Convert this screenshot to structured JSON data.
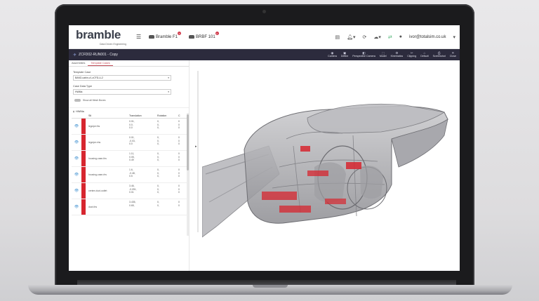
{
  "app": {
    "logo": "bramble",
    "logo_tagline": "Data Driven Engineering",
    "tabs": [
      {
        "label": "Bramble F1"
      },
      {
        "label": "BRBF 101"
      }
    ],
    "user_email": "ivor@totalsim.co.uk"
  },
  "toolbar": {
    "project_title": "ZCFD02-RUN001 - Copy",
    "buttons": [
      {
        "label": "Camera",
        "icon": "camera-icon"
      },
      {
        "label": "Define",
        "icon": "define-icon"
      },
      {
        "label": "Perspective Camera",
        "icon": "perspective-camera-icon"
      },
      {
        "label": "Model",
        "icon": "model-icon"
      },
      {
        "label": "Kinematics",
        "icon": "kinematics-icon"
      },
      {
        "label": "Clipping",
        "icon": "clipping-icon"
      },
      {
        "label": "Default",
        "icon": "default-icon"
      },
      {
        "label": "Screenshot",
        "icon": "screenshot-icon"
      },
      {
        "label": "Close",
        "icon": "close-icon"
      }
    ]
  },
  "panel": {
    "tabs": [
      {
        "label": "Assemblies"
      },
      {
        "label": "Template Cases"
      }
    ],
    "template_case_label": "Template Case",
    "template_case_value": "BAND-cabin-v1-zCFD-LL2",
    "case_data_type_label": "Case Data Type",
    "case_data_type_value": "HWMa",
    "toggle_label": "Show all Mesh Boxes",
    "section_title": "HWMa",
    "table": {
      "headers": [
        "Stl",
        "Translation",
        "Rotation",
        "C"
      ],
      "rows": [
        {
          "stl": "legclpe.ths",
          "translation": [
            "0.01,",
            "0.0,",
            "0.0"
          ],
          "rotation": [
            "0,",
            "0,",
            "0,"
          ],
          "extra": [
            "0",
            "0",
            "0"
          ]
        },
        {
          "stl": "legclpe.nhs",
          "translation": [
            "0.01,",
            "-0.03,",
            "0.0"
          ],
          "rotation": [
            "0,",
            "0,",
            "0,"
          ],
          "extra": [
            "0",
            "0",
            "0"
          ]
        },
        {
          "stl": "housing-case-ths",
          "translation": [
            "1.11,",
            "0.05,",
            "0.49"
          ],
          "rotation": [
            "0,",
            "0,",
            "0,"
          ],
          "extra": [
            "0",
            "0",
            "0"
          ]
        },
        {
          "stl": "housing-case-rhs",
          "translation": [
            "1.6,",
            "-0.48,",
            "0.5"
          ],
          "rotation": [
            "0,",
            "0,",
            "0,"
          ],
          "extra": [
            "0",
            "0",
            "0"
          ]
        },
        {
          "stl": "centre-duct-outlet",
          "translation": [
            "3.46,",
            "-0.091,",
            "0.01"
          ],
          "rotation": [
            "0,",
            "0,",
            "0,"
          ],
          "extra": [
            "0",
            "0",
            "0"
          ]
        },
        {
          "stl": "duct-ths",
          "translation": [
            "3.435,",
            "0.65,",
            ""
          ],
          "rotation": [
            "0,",
            "0,",
            ""
          ],
          "extra": [
            "0",
            "0",
            ""
          ]
        }
      ]
    }
  },
  "colors": {
    "accent": "#d7262f",
    "toolbar_bg": "#2c2b3d",
    "logo": "#3a3f4b"
  }
}
